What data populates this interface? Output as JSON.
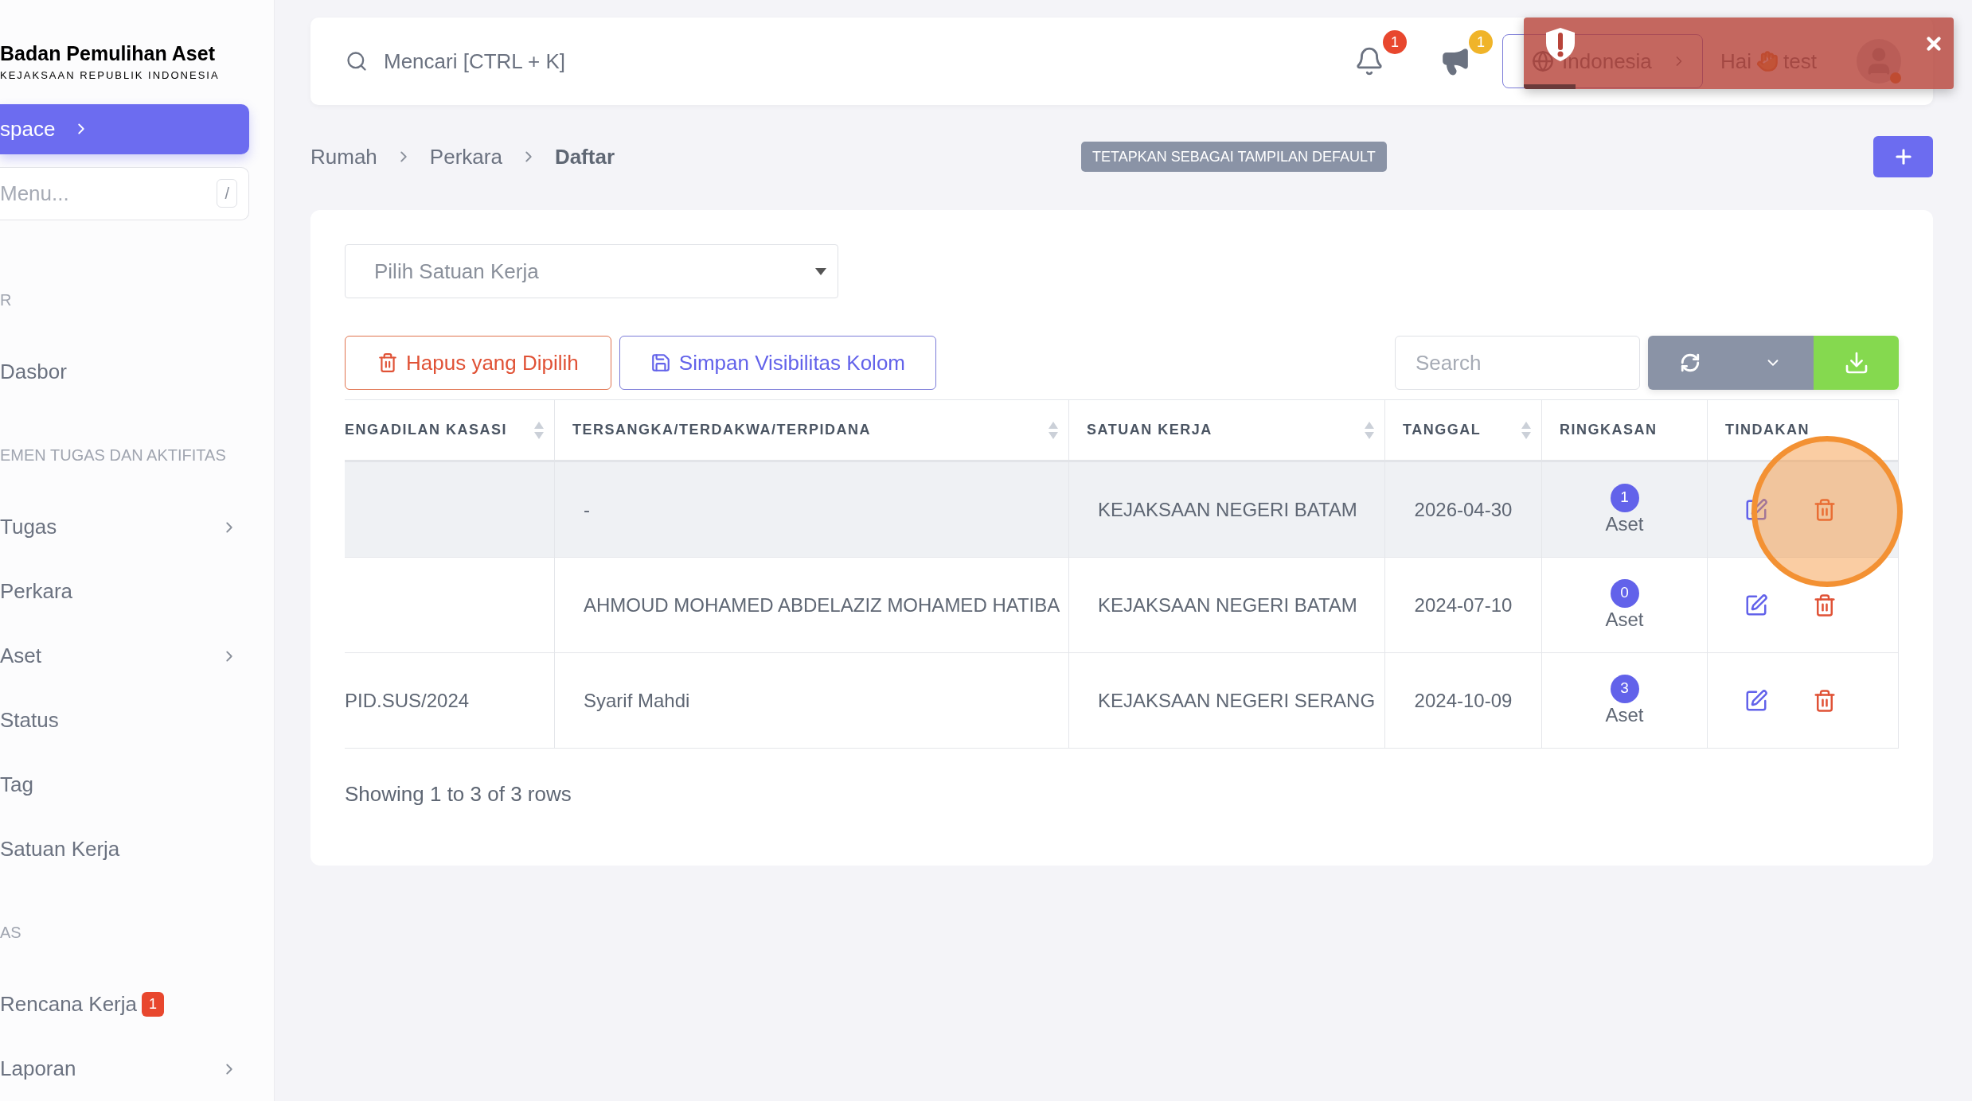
{
  "sidebar": {
    "brand": {
      "title": "Badan Pemulihan Aset",
      "subtitle": "KEJAKSAAN REPUBLIK INDONESIA"
    },
    "workspace_button": "space",
    "menu_search": {
      "placeholder": "Menu...",
      "shortcut": "/"
    },
    "sections": [
      {
        "heading": "R",
        "items": [
          {
            "label": "Dasbor",
            "has_submenu": false
          }
        ]
      },
      {
        "heading": "EMEN TUGAS DAN AKTIFITAS",
        "items": [
          {
            "label": "Tugas",
            "has_submenu": true
          },
          {
            "label": "Perkara",
            "has_submenu": false
          },
          {
            "label": "Aset",
            "has_submenu": true
          },
          {
            "label": "Status",
            "has_submenu": false
          },
          {
            "label": "Tag",
            "has_submenu": false
          },
          {
            "label": "Satuan Kerja",
            "has_submenu": false
          }
        ]
      },
      {
        "heading": "AS",
        "items": [
          {
            "label": "Rencana Kerja",
            "has_submenu": false,
            "badge": "1"
          },
          {
            "label": "Laporan",
            "has_submenu": true
          }
        ]
      }
    ]
  },
  "topbar": {
    "search_placeholder": "Mencari [CTRL + K]",
    "notifications_count": "1",
    "announcements_count": "1",
    "language": "Indonesia",
    "greeting": "Hai",
    "user": "test"
  },
  "toast": {
    "visible": true,
    "level": 0.12
  },
  "breadcrumbs": [
    {
      "label": "Rumah",
      "current": false
    },
    {
      "label": "Perkara",
      "current": false
    },
    {
      "label": "Daftar",
      "current": true
    }
  ],
  "default_view_button": "TETAPKAN SEBAGAI TAMPILAN DEFAULT",
  "filter": {
    "placeholder": "Pilih Satuan Kerja"
  },
  "actions": [
    {
      "kind": "delete",
      "label": "Hapus yang Dipilih"
    },
    {
      "kind": "save",
      "label": "Simpan Visibilitas Kolom"
    }
  ],
  "table_search": {
    "placeholder": "Search"
  },
  "table": {
    "columns": [
      {
        "label": "ENGADILAN KASASI",
        "sortable": true
      },
      {
        "label": "TERSANGKA/TERDAKWA/TERPIDANA",
        "sortable": true
      },
      {
        "label": "SATUAN KERJA",
        "sortable": true
      },
      {
        "label": "TANGGAL",
        "sortable": true
      },
      {
        "label": "RINGKASAN",
        "sortable": false
      },
      {
        "label": "TINDAKAN",
        "sortable": false
      }
    ],
    "rows": [
      {
        "highlighted": true,
        "suspect": "-",
        "unit": "KEJAKSAAN NEGERI BATAM",
        "date": "2026-04-30",
        "summary_count": "1",
        "summary_label": "Aset"
      },
      {
        "highlighted": false,
        "suspect": "AHMOUD MOHAMED ABDELAZIZ MOHAMED HATIBA",
        "unit": "KEJAKSAAN NEGERI BATAM",
        "date": "2024-07-10",
        "summary_count": "0",
        "summary_label": "Aset"
      },
      {
        "highlighted": false,
        "column_1": "PID.SUS/2024",
        "suspect": "Syarif Mahdi",
        "unit": "KEJAKSAAN NEGERI SERANG",
        "date": "2024-10-09",
        "summary_count": "3",
        "summary_label": "Aset"
      }
    ]
  },
  "footer": "Showing 1 to 3 of 3 rows",
  "tap_indicator": {
    "visible": true
  }
}
